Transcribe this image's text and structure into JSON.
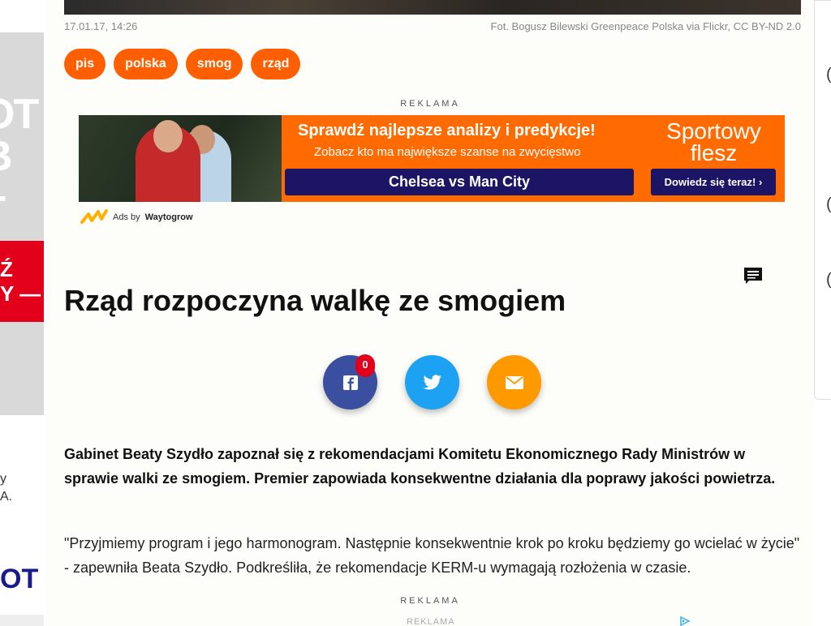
{
  "left_panel": {
    "grey_text": "OT\nB\n+",
    "red_text": "Ź\nY —",
    "below_text": "y\nA.",
    "logo_text": "OT"
  },
  "right_panel": {
    "chars": [
      "(",
      "(",
      "("
    ]
  },
  "article": {
    "date": "17.01.17, 14:26",
    "photo_caption": "Fot. Bogusz Bilewski Greenpeace Polska via Flickr, CC BY-ND 2.0",
    "tags": [
      "pis",
      "polska",
      "smog",
      "rząd"
    ],
    "title": "Rząd rozpoczyna walkę ze smogiem",
    "lead": "Gabinet Beaty Szydło zapoznał się z rekomendacjami Komitetu Ekonomicznego Rady Ministrów w sprawie walki ze smogiem. Premier zapowiada konsekwentne działania dla poprawy jakości powietrza.",
    "paragraph": "\"Przyjmiemy program i jego harmonogram. Następnie konsekwentnie krok po kroku będziemy go wcielać w życie\" - zapewniła Beata Szydło. Podkreśliła, że rekomendacje KERM-u wymagają rozłożenia w czasie."
  },
  "ad": {
    "label": "REKLAMA",
    "headline": "Sprawdź najlepsze analizy i predykcje!",
    "subline": "Zobacz kto ma największe szanse na zwycięstwo",
    "match": "Chelsea vs Man City",
    "brand_line1": "Sportowy",
    "brand_line2": "flesz",
    "cta": "Dowiedz się teraz! ›",
    "ads_by_prefix": "Ads by",
    "ads_by_name": "Waytogrow"
  },
  "share": {
    "facebook_count": "0"
  },
  "bottom": {
    "reklama_label": "REKLAMA",
    "reklama_small": "REKLAMA"
  },
  "colors": {
    "tag": "#ff5f00",
    "facebook": "#3b4fa0",
    "twitter": "#1da1f2",
    "mail": "#ff9900",
    "ad_bg": "#ff6b00",
    "ad_dark": "#1c1464"
  }
}
